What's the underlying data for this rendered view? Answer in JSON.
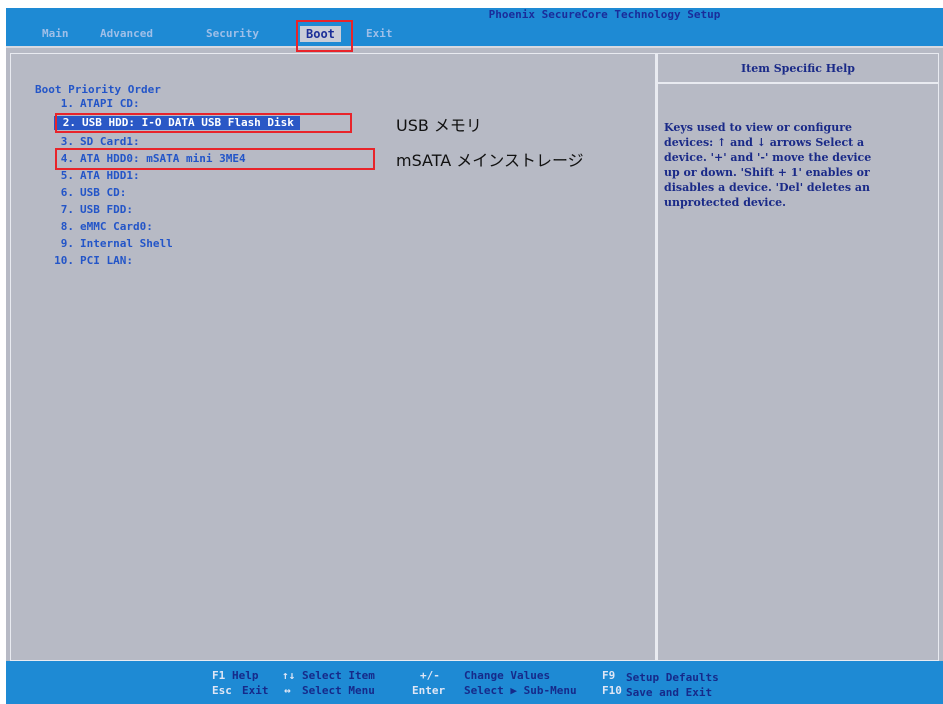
{
  "title": "Phoenix SecureCore Technology Setup",
  "menu": [
    {
      "label": "Main",
      "active": false
    },
    {
      "label": "Advanced",
      "active": false
    },
    {
      "label": "Security",
      "active": false
    },
    {
      "label": "Boot",
      "active": true
    },
    {
      "label": "Exit",
      "active": false
    }
  ],
  "boot": {
    "section_title": "Boot Priority Order",
    "items": [
      {
        "num": "1.",
        "label": "ATAPI CD:"
      },
      {
        "num": "2.",
        "label": "USB HDD: I-O DATA USB Flash Disk"
      },
      {
        "num": "3.",
        "label": "SD Card1:"
      },
      {
        "num": "4.",
        "label": "ATA HDD0: mSATA mini 3ME4"
      },
      {
        "num": "5.",
        "label": "ATA HDD1:"
      },
      {
        "num": "6.",
        "label": "USB CD:"
      },
      {
        "num": "7.",
        "label": "USB FDD:"
      },
      {
        "num": "8.",
        "label": "eMMC Card0:"
      },
      {
        "num": "9.",
        "label": "Internal Shell"
      },
      {
        "num": "10.",
        "label": "PCI LAN:"
      }
    ]
  },
  "annotations": {
    "usb": "USB メモリ",
    "msata": "mSATA メインストレージ"
  },
  "help": {
    "header": "Item Specific Help",
    "text": "Keys used to view or configure\ndevices: ↑ and ↓ arrows Select a\ndevice. '+' and '-' move the device\nup or down. 'Shift + 1' enables or\ndisables a device. 'Del' deletes an\nunprotected device."
  },
  "footer": {
    "row1": [
      {
        "key": "F1",
        "desc": "Help"
      },
      {
        "key": "↑↓",
        "desc": "Select Item"
      },
      {
        "key": "+/-",
        "desc": "Change Values"
      },
      {
        "key": "F9",
        "desc": "Setup Defaults"
      }
    ],
    "row2": [
      {
        "key": "Esc",
        "desc": "Exit"
      },
      {
        "key": "↔",
        "desc": "Select Menu"
      },
      {
        "key": "Enter",
        "desc": "Select ▶ Sub-Menu"
      },
      {
        "key": "F10",
        "desc": "Save and Exit"
      }
    ]
  },
  "colors": {
    "bar_blue": "#1e8ad4",
    "panel_gray": "#b7bac5",
    "text_blue": "#2355c8",
    "highlight_red": "#e8242a"
  }
}
